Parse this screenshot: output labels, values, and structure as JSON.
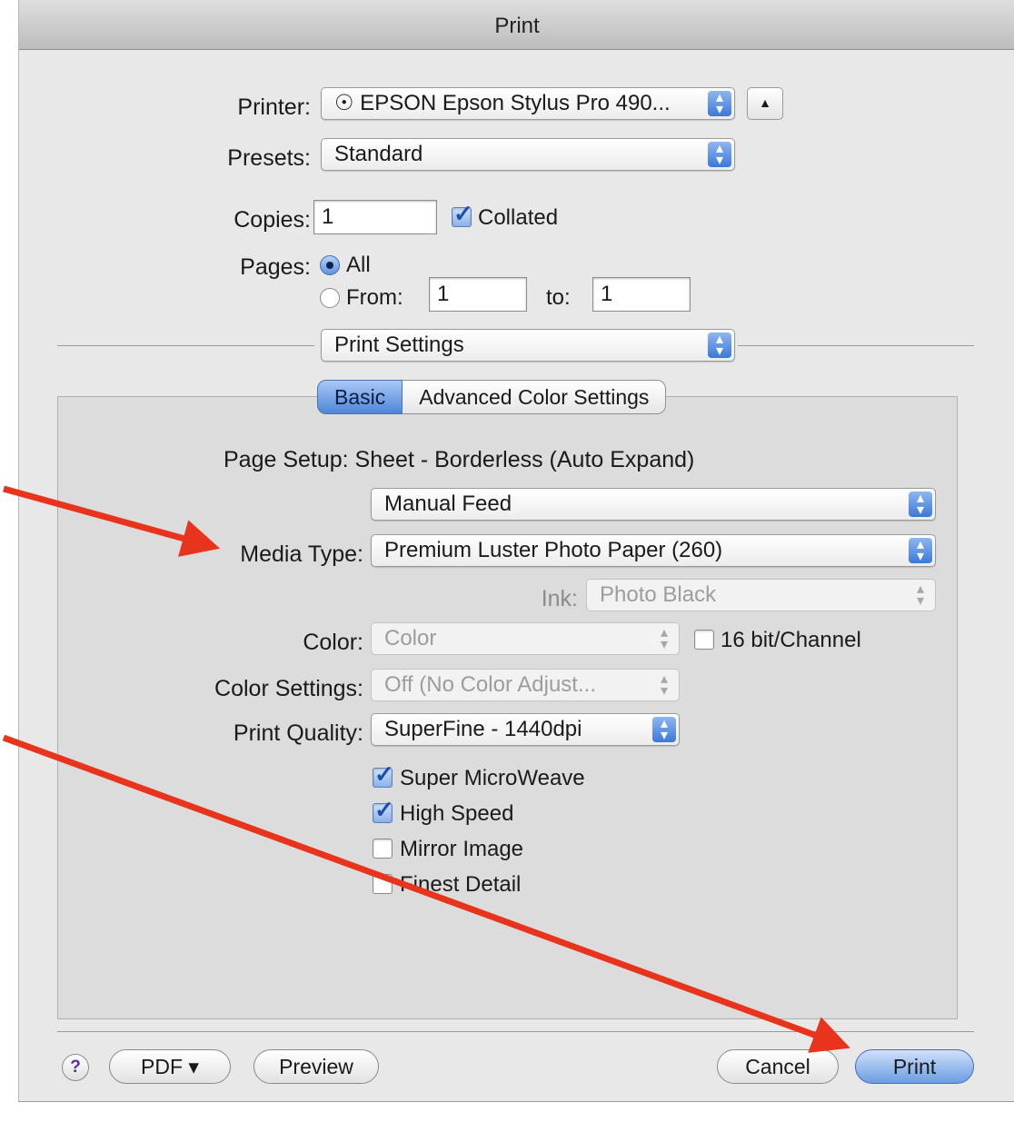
{
  "window": {
    "title": "Print"
  },
  "printer": {
    "label": "Printer:",
    "value": "☉ EPSON Epson Stylus Pro 490...",
    "disclosure_icon": "▲"
  },
  "presets": {
    "label": "Presets:",
    "value": "Standard"
  },
  "copies": {
    "label": "Copies:",
    "value": "1",
    "collated_label": "Collated",
    "collated_checked": true
  },
  "pages": {
    "label": "Pages:",
    "all_label": "All",
    "from_label": "From:",
    "from_value": "1",
    "to_label": "to:",
    "to_value": "1",
    "selected": "All"
  },
  "section_popup": {
    "value": "Print Settings"
  },
  "tabs": [
    {
      "label": "Basic",
      "selected": true
    },
    {
      "label": "Advanced Color Settings",
      "selected": false
    }
  ],
  "page_setup": {
    "text": "Page Setup: Sheet - Borderless (Auto Expand)"
  },
  "feed": {
    "value": "Manual Feed"
  },
  "media_type": {
    "label": "Media Type:",
    "value": "Premium Luster Photo Paper (260)"
  },
  "ink": {
    "label": "Ink:",
    "value": "Photo Black",
    "enabled": false
  },
  "color": {
    "label": "Color:",
    "value": "Color",
    "enabled": false,
    "bit_label": "16 bit/Channel",
    "bit_checked": false
  },
  "color_settings": {
    "label": "Color Settings:",
    "value": "Off (No Color Adjust...",
    "enabled": false
  },
  "print_quality": {
    "label": "Print Quality:",
    "value": "SuperFine - 1440dpi"
  },
  "options": [
    {
      "label": "Super MicroWeave",
      "checked": true
    },
    {
      "label": "High Speed",
      "checked": true
    },
    {
      "label": "Mirror Image",
      "checked": false
    },
    {
      "label": "Finest Detail",
      "checked": false
    }
  ],
  "buttons": {
    "help": "?",
    "pdf": "PDF ▾",
    "preview": "Preview",
    "cancel": "Cancel",
    "print": "Print"
  },
  "annotation": {
    "arrow_color": "#e8341c"
  }
}
